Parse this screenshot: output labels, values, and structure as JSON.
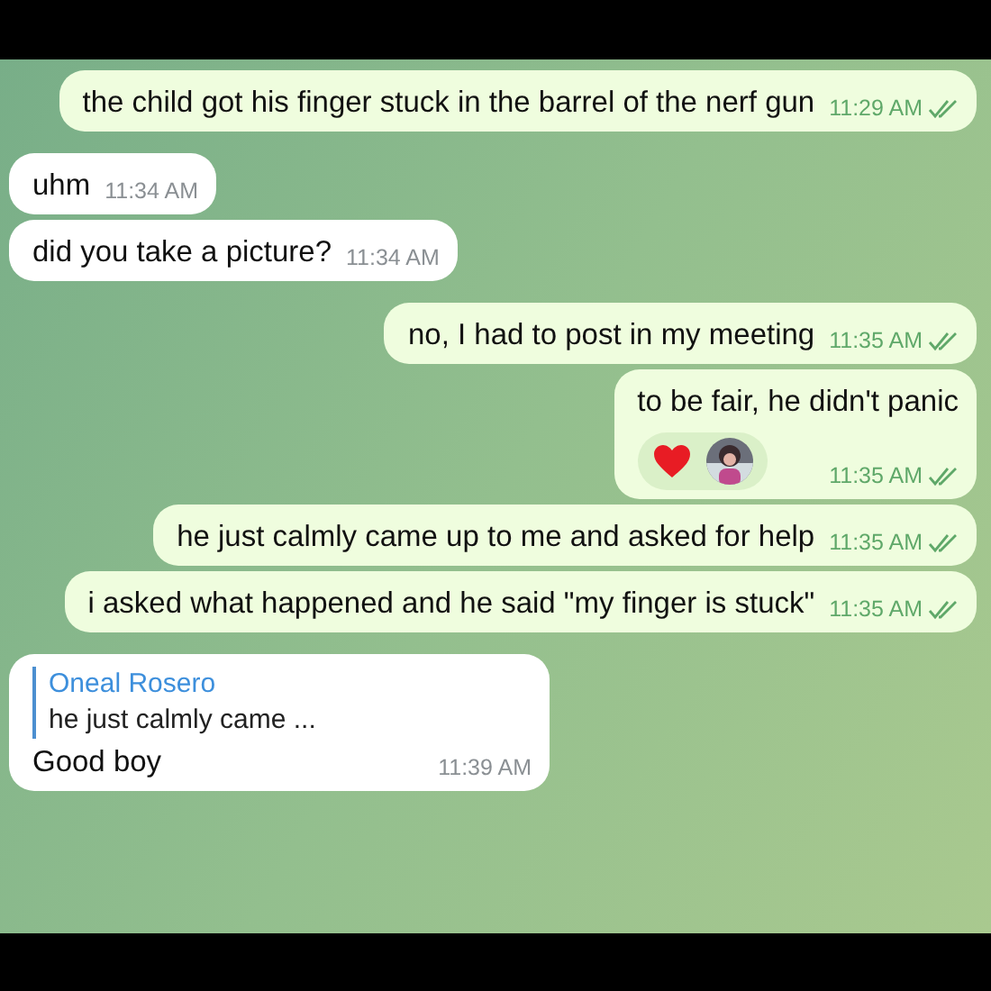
{
  "messages": [
    {
      "kind": "outgoing",
      "text": "the child got his finger stuck in the barrel of the nerf gun",
      "time": "11:29 AM",
      "read": true
    },
    {
      "kind": "incoming",
      "text": "uhm",
      "time": "11:34 AM"
    },
    {
      "kind": "incoming",
      "text": "did you take a picture?",
      "time": "11:34 AM"
    },
    {
      "kind": "outgoing",
      "text": "no, I had to post in my meeting",
      "time": "11:35 AM",
      "read": true
    },
    {
      "kind": "outgoing",
      "text": "to be fair, he didn't panic",
      "time": "11:35 AM",
      "read": true,
      "reactions": [
        {
          "kind": "heart"
        },
        {
          "kind": "avatar"
        }
      ]
    },
    {
      "kind": "outgoing",
      "text": "he just calmly came up to me and asked for help",
      "time": "11:35 AM",
      "read": true
    },
    {
      "kind": "outgoing",
      "text": "i asked what happened and he said \"my finger is stuck\"",
      "time": "11:35 AM",
      "read": true
    },
    {
      "kind": "incoming",
      "reply": {
        "name": "Oneal Rosero",
        "text": "he just calmly came ..."
      },
      "text": "Good boy",
      "time": "11:39 AM"
    }
  ]
}
